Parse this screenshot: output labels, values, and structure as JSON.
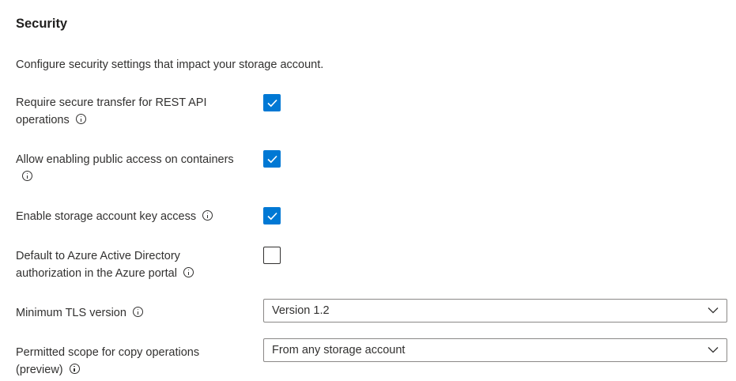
{
  "security": {
    "title": "Security",
    "description": "Configure security settings that impact your storage account.",
    "settings": {
      "secure_transfer": {
        "label": "Require secure transfer for REST API operations",
        "checked": true
      },
      "public_access": {
        "label": "Allow enabling public access on containers",
        "checked": true
      },
      "key_access": {
        "label": "Enable storage account key access",
        "checked": true
      },
      "aad_default": {
        "label": "Default to Azure Active Directory authorization in the Azure portal",
        "checked": false
      },
      "min_tls": {
        "label": "Minimum TLS version",
        "value": "Version 1.2"
      },
      "copy_scope": {
        "label": "Permitted scope for copy operations (preview)",
        "value": "From any storage account"
      }
    }
  },
  "colors": {
    "accent": "#0078d4",
    "text": "#323130",
    "border": "#8a8886"
  },
  "icons": {
    "info": "info-icon",
    "check": "checkmark-icon",
    "dropdown": "chevron-down-icon"
  }
}
